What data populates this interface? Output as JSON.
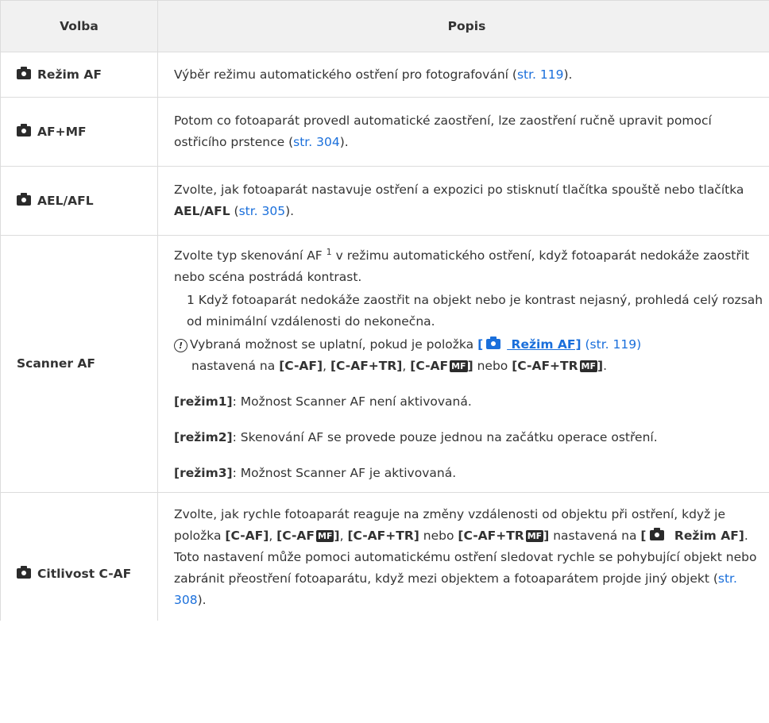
{
  "header": {
    "col_option": "Volba",
    "col_description": "Popis"
  },
  "icons": {
    "camera": "camera-icon",
    "notice": "notice-icon",
    "mf_badge": "MF"
  },
  "colors": {
    "link": "#1a6fdb",
    "header_bg": "#f1f1f1",
    "border": "#dcdcdc"
  },
  "rows": [
    {
      "option": "Režim AF",
      "desc_text": "Výběr režimu automatického ostření pro fotografování (",
      "link": "str. 119",
      "desc_end": ")."
    },
    {
      "option": "AF+MF",
      "desc_text": "Potom co fotoaparát provedl automatické zaostření, lze zaostření ručně upravit pomocí ostřicího prstence (",
      "link": "str. 304",
      "desc_end": ")."
    },
    {
      "option": "AEL/AFL",
      "desc_text": "Zvolte, jak fotoaparát nastavuje ostření a expozici po stisknutí tlačítka spouště nebo tlačítka ",
      "desc_bold": "AEL/AFL",
      "desc_mid": " (",
      "link": "str. 305",
      "desc_end": ")."
    },
    {
      "option": "Scanner AF",
      "intro_a": "Zvolte typ skenování AF",
      "intro_sup": "1",
      "intro_b": " v režimu automatického ostření, když fotoaparát nedokáže zaostřit nebo scéna postrádá kontrast.",
      "footnote": "1  Když fotoaparát nedokáže zaostřit na objekt nebo je kontrast nejasný, prohledá celý rozsah od minimální vzdálenosti do nekonečna.",
      "notice_a": "Vybraná možnost se uplatní, pokud je položka ",
      "notice_link_open": "[",
      "notice_link_text": " Režim AF]",
      "notice_page": "(str. 119)",
      "notice_b": "nastavená na ",
      "notice_opt1": "[C-AF]",
      "notice_opt2": "[C-AF+TR]",
      "notice_opt3_a": "[C-AF",
      "notice_opt3_b": "]",
      "notice_or": " nebo ",
      "notice_opt4_a": "[C-AF+TR",
      "notice_opt4_b": "]",
      "sep": ", ",
      "dot": ".",
      "mode1_label": "[režim1]",
      "mode1_text": ": Možnost Scanner AF není aktivovaná.",
      "mode2_label": "[režim2]",
      "mode2_text": ": Skenování AF se provede pouze jednou na začátku operace ostření.",
      "mode3_label": "[režim3]",
      "mode3_text": ": Možnost Scanner AF je aktivovaná."
    },
    {
      "option": "Citlivost C-AF",
      "t1": "Zvolte, jak rychle fotoaparát reaguje na změny vzdálenosti od objektu při ostření, když je položka ",
      "o1": "[C-AF]",
      "sep": ", ",
      "o2a": "[C-AF",
      "o2b": "]",
      "o3": "[C-AF+TR]",
      "or": " nebo ",
      "o4a": "[C-AF+TR",
      "o4b": "]",
      "t2": " nastavená na ",
      "o5a": "[",
      "o5b": " Režim AF]",
      "t3": ". Toto nastavení může pomoci automatickému ostření sledovat rychle se pohybující objekt nebo zabránit přeostření fotoaparátu, když mezi objektem a fotoaparátem projde jiný objekt (",
      "link": "str. 308",
      "end": ")."
    }
  ]
}
